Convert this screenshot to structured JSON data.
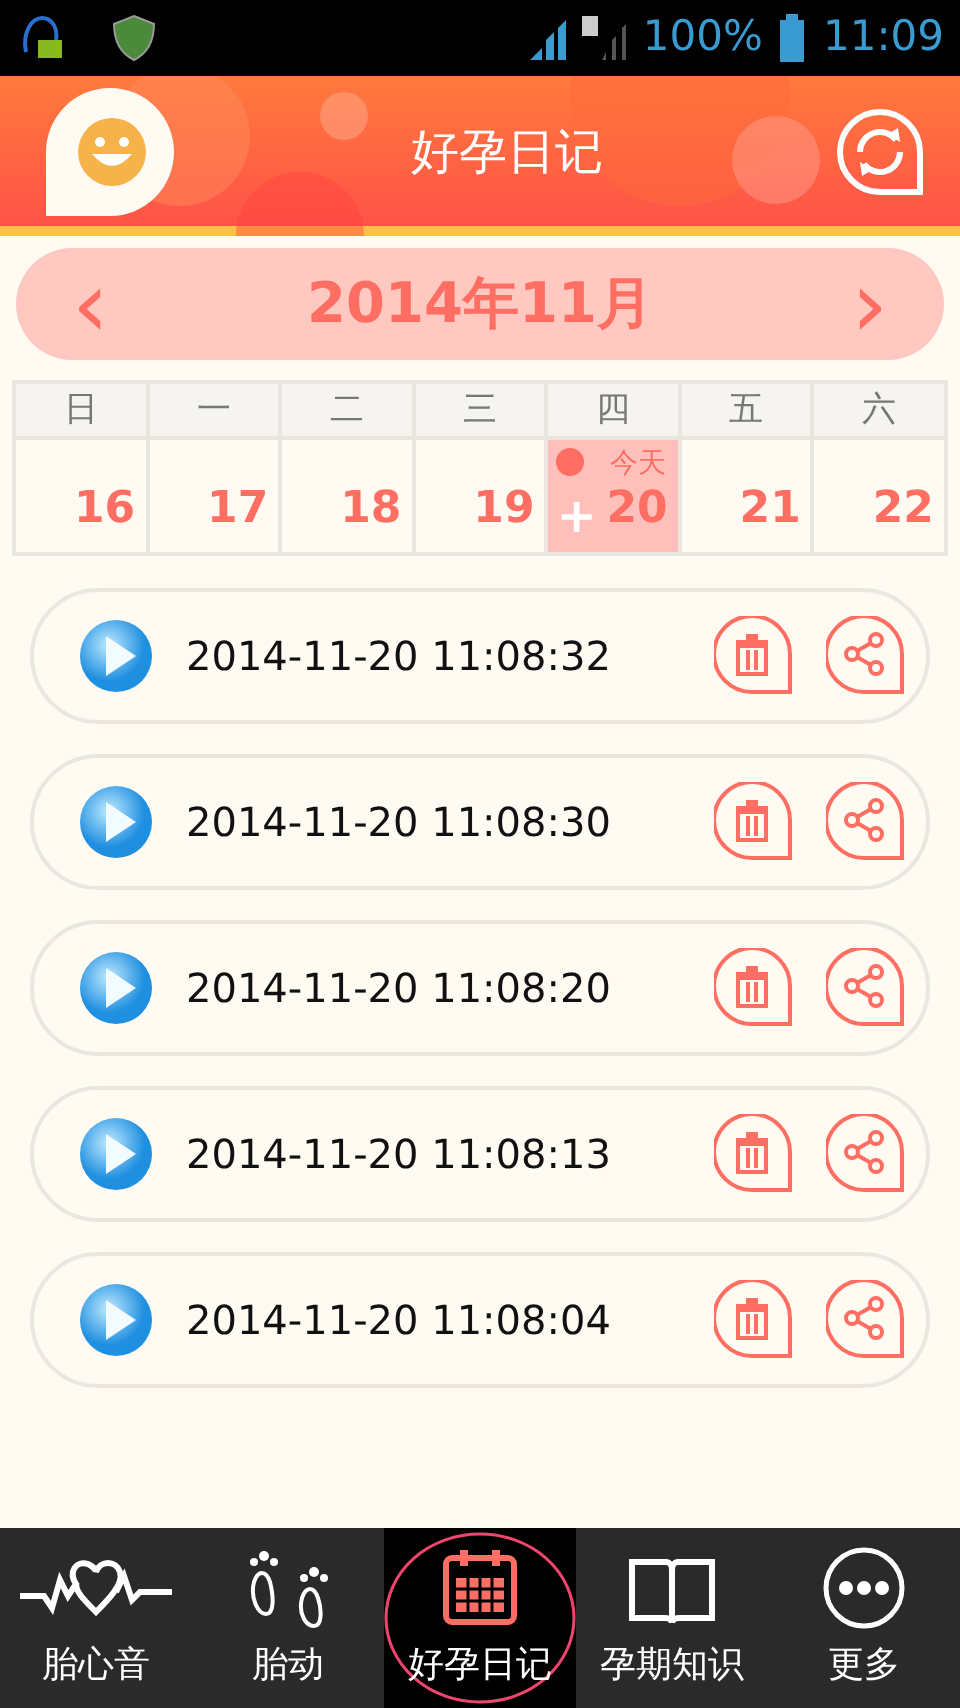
{
  "status_bar": {
    "battery": "100%",
    "time": "11:09"
  },
  "header": {
    "title": "好孕日记"
  },
  "month": {
    "prev": "‹",
    "label": "2014年11月",
    "next": "›"
  },
  "weekdays": [
    "日",
    "一",
    "二",
    "三",
    "四",
    "五",
    "六"
  ],
  "days": [
    {
      "day": "16",
      "today": false
    },
    {
      "day": "17",
      "today": false
    },
    {
      "day": "18",
      "today": false
    },
    {
      "day": "19",
      "today": false
    },
    {
      "day": "20",
      "today": true,
      "today_label": "今天",
      "add": "+"
    },
    {
      "day": "21",
      "today": false
    },
    {
      "day": "22",
      "today": false
    }
  ],
  "records": [
    {
      "time": "2014-11-20 11:08:32"
    },
    {
      "time": "2014-11-20 11:08:30"
    },
    {
      "time": "2014-11-20 11:08:20"
    },
    {
      "time": "2014-11-20 11:08:13"
    },
    {
      "time": "2014-11-20 11:08:04"
    }
  ],
  "nav": [
    {
      "label": "胎心音",
      "kind": "heartbeat",
      "selected": false
    },
    {
      "label": "胎动",
      "kind": "feet",
      "selected": false
    },
    {
      "label": "好孕日记",
      "kind": "calendar",
      "selected": true
    },
    {
      "label": "孕期知识",
      "kind": "book",
      "selected": false
    },
    {
      "label": "更多",
      "kind": "more",
      "selected": false
    }
  ]
}
